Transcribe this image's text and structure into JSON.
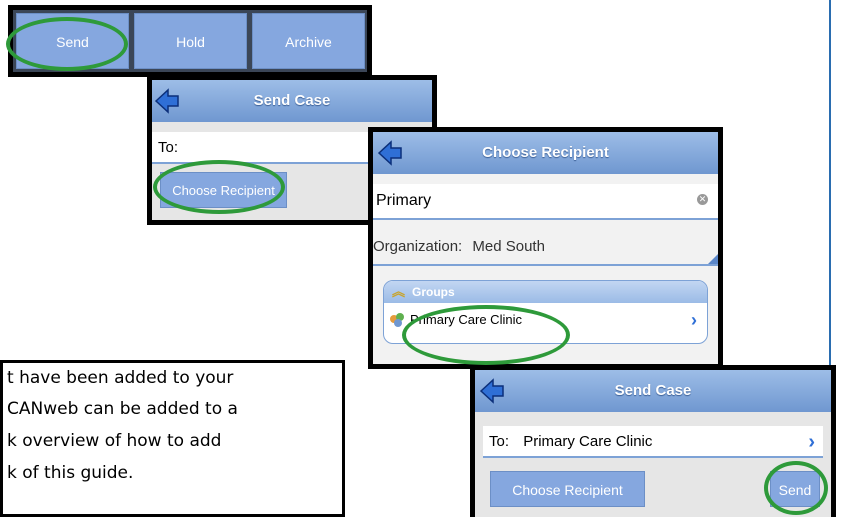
{
  "toolbar": {
    "send_label": "Send",
    "hold_label": "Hold",
    "archive_label": "Archive"
  },
  "send_case_1": {
    "title": "Send Case",
    "to_label": "To:",
    "choose_label": "Choose Recipient"
  },
  "choose_recipient": {
    "title": "Choose Recipient",
    "search_value": "Primary",
    "org_label": "Organization:",
    "org_value": "Med South",
    "groups_label": "Groups",
    "group_item": "Primary Care Clinic"
  },
  "send_case_2": {
    "title": "Send Case",
    "to_label": "To:",
    "to_value": "Primary Care Clinic",
    "choose_label": "Choose Recipient",
    "send_label": "Send"
  },
  "guide_text": {
    "line1": "t have been added to your",
    "line2": "CANweb can be added to a",
    "line3": "k overview of how to add",
    "line4": "k of this guide."
  },
  "colors": {
    "accent": "#6f97d0",
    "highlight_ring": "#2e9a3a",
    "button": "#85a7df"
  }
}
